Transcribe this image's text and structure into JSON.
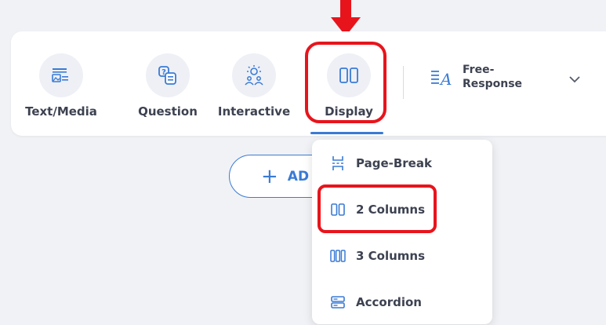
{
  "toolbar": {
    "tools": [
      {
        "label": "Text/Media",
        "icon": "text-media-icon"
      },
      {
        "label": "Question",
        "icon": "question-icon"
      },
      {
        "label": "Interactive",
        "icon": "interactive-icon"
      },
      {
        "label": "Display",
        "icon": "two-columns-icon",
        "selected": true
      }
    ],
    "free_response": {
      "line1": "Free-",
      "line2": "Response",
      "icon": "free-response-icon"
    },
    "dropdown_icon": "chevron-down-icon"
  },
  "add_button": {
    "label": "AD"
  },
  "display_menu": {
    "items": [
      {
        "label": "Page-Break",
        "icon": "page-break-icon"
      },
      {
        "label": "2 Columns",
        "icon": "two-columns-icon"
      },
      {
        "label": "3 Columns",
        "icon": "three-columns-icon"
      },
      {
        "label": "Accordion",
        "icon": "accordion-icon"
      }
    ]
  },
  "colors": {
    "accent": "#3a7bd5",
    "highlight": "#e8141c",
    "background": "#f1f2f6",
    "icon_circle": "#eef0f6"
  }
}
